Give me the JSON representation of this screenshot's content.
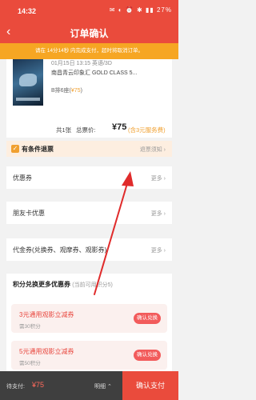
{
  "status_bar": {
    "time": "14:32",
    "icons": "✉ ◐ ⏰ ✱ ▮▮ 27%"
  },
  "nav": {
    "back_icon": "‹",
    "title": "订单确认"
  },
  "notice": "请在 14分14秒 内完成支付，超时将取消订单。",
  "movie": {
    "time": "01月15日 13:15 英语/3D",
    "cinema": "南昌青云印象汇 GOLD CLASS 5...",
    "seat": "B排6座(",
    "seat_price": "¥75",
    "seat_close": ")"
  },
  "summary": {
    "count": "共1张",
    "total_label": "总票价:",
    "total": "¥75",
    "fee": "(含3元服务费)"
  },
  "refund": {
    "check": "✓",
    "label": "有条件退票",
    "link": "退票须知 ›"
  },
  "coupon": {
    "label": "优惠券",
    "more": "更多 ›"
  },
  "friend_card": {
    "label": "朋友卡优惠",
    "more": "更多 ›"
  },
  "voucher": {
    "label": "代金券(兑换券、观摩券、观影券)",
    "more": "更多 ›"
  },
  "points": {
    "title": "积分兑换更多优惠券",
    "subtitle": "(当前可用积分5)",
    "items": [
      {
        "name": "3元通用观影立减券",
        "cost": "需30积分",
        "button": "确认兑换"
      },
      {
        "name": "5元通用观影立减券",
        "cost": "需50积分",
        "button": "确认兑换"
      }
    ]
  },
  "bottom": {
    "pay_label": "待支付:",
    "pay_amount": "¥75",
    "detail": "明细 ⌃",
    "confirm": "确认支付"
  },
  "colors": {
    "brand": "#ea4b3c",
    "notice": "#f6a623",
    "accent": "#f0a030"
  }
}
